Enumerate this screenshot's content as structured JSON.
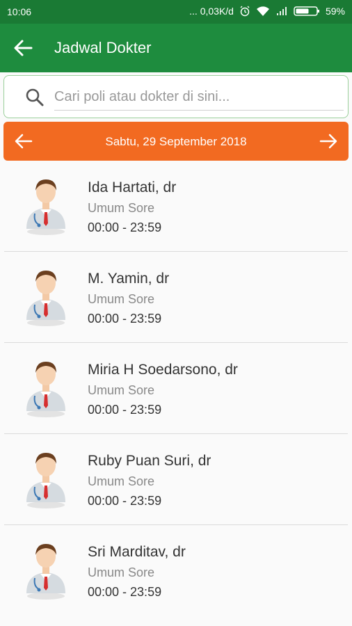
{
  "status": {
    "time": "10:06",
    "network": "... 0,03K/d",
    "battery": "59%"
  },
  "appbar": {
    "title": "Jadwal Dokter"
  },
  "search": {
    "placeholder": "Cari poli atau dokter di sini..."
  },
  "date": {
    "label": "Sabtu, 29 September 2018"
  },
  "doctors": [
    {
      "name": "Ida Hartati, dr",
      "specialty": "Umum Sore",
      "hours": "00:00 - 23:59"
    },
    {
      "name": "M. Yamin, dr",
      "specialty": "Umum Sore",
      "hours": "00:00 - 23:59"
    },
    {
      "name": "Miria H Soedarsono, dr",
      "specialty": "Umum Sore",
      "hours": "00:00 - 23:59"
    },
    {
      "name": "Ruby Puan Suri, dr",
      "specialty": "Umum Sore",
      "hours": "00:00 - 23:59"
    },
    {
      "name": "Sri Marditav, dr",
      "specialty": "Umum Sore",
      "hours": "00:00 - 23:59"
    }
  ],
  "icons": {
    "back": "arrow-left-icon",
    "search": "search-icon",
    "prev": "arrow-left-icon",
    "next": "arrow-right-icon",
    "avatar": "doctor-avatar-icon"
  },
  "colors": {
    "statusbar": "#1a7a34",
    "appbar": "#1e8c3e",
    "datebar": "#f26a21"
  }
}
